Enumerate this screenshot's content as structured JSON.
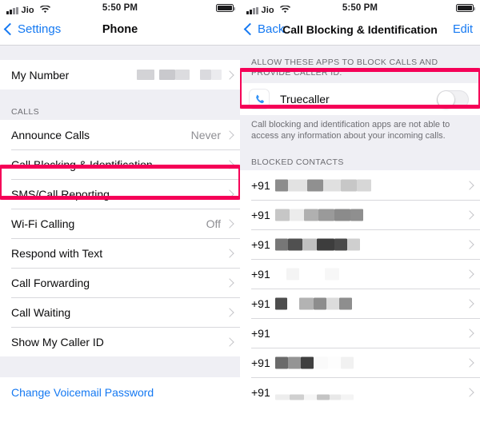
{
  "status_bar": {
    "carrier": "Jio",
    "time": "5:50 PM",
    "signal_icon": "cellular-bars-icon",
    "wifi_icon": "wifi-icon",
    "battery_icon": "battery-full-icon"
  },
  "left_panel": {
    "nav": {
      "back_label": "Settings",
      "title": "Phone",
      "back_icon": "chevron-left-icon"
    },
    "sections": [
      {
        "header": "",
        "rows": [
          {
            "label": "My Number",
            "value": "",
            "redacted": true,
            "accessory": "chevron-right-icon"
          }
        ]
      },
      {
        "header": "CALLS",
        "rows": [
          {
            "label": "Announce Calls",
            "value": "Never",
            "accessory": "chevron-right-icon"
          },
          {
            "label": "Call Blocking & Identification",
            "value": "",
            "accessory": "chevron-right-icon",
            "highlighted": true
          },
          {
            "label": "SMS/Call Reporting",
            "value": "",
            "accessory": "chevron-right-icon"
          },
          {
            "label": "Wi-Fi Calling",
            "value": "Off",
            "accessory": "chevron-right-icon"
          },
          {
            "label": "Respond with Text",
            "value": "",
            "accessory": "chevron-right-icon"
          },
          {
            "label": "Call Forwarding",
            "value": "",
            "accessory": "chevron-right-icon"
          },
          {
            "label": "Call Waiting",
            "value": "",
            "accessory": "chevron-right-icon"
          },
          {
            "label": "Show My Caller ID",
            "value": "",
            "accessory": "chevron-right-icon"
          }
        ]
      }
    ],
    "voicemail_link": "Change Voicemail Password"
  },
  "right_panel": {
    "nav": {
      "back_label": "Back",
      "title": "Call Blocking & Identification",
      "edit_label": "Edit",
      "back_icon": "chevron-left-icon"
    },
    "apps_section": {
      "header": "ALLOW THESE APPS TO BLOCK CALLS AND PROVIDE CALLER ID:",
      "apps": [
        {
          "name": "Truecaller",
          "icon": "phone-handset-icon",
          "toggle_state": "off",
          "highlighted": true
        }
      ],
      "footer": "Call blocking and identification apps are not able to access any information about your incoming calls."
    },
    "blocked_section": {
      "header": "BLOCKED CONTACTS",
      "country_code": "+91",
      "rows": [
        {
          "prefix": "+91",
          "number": "",
          "redacted": true,
          "accessory": "chevron-right-icon"
        },
        {
          "prefix": "+91",
          "number": "",
          "redacted": true,
          "accessory": "chevron-right-icon"
        },
        {
          "prefix": "+91",
          "number": "",
          "redacted": true,
          "accessory": "chevron-right-icon"
        },
        {
          "prefix": "+91",
          "number": "",
          "redacted": true,
          "accessory": "chevron-right-icon"
        },
        {
          "prefix": "+91",
          "number": "",
          "redacted": true,
          "accessory": "chevron-right-icon"
        },
        {
          "prefix": "+91",
          "number": "",
          "redacted": true,
          "accessory": "chevron-right-icon"
        },
        {
          "prefix": "+91",
          "number": "",
          "redacted": true,
          "accessory": "chevron-right-icon"
        },
        {
          "prefix": "+91",
          "number": "",
          "redacted": true,
          "accessory": "chevron-right-icon"
        }
      ]
    }
  },
  "colors": {
    "highlight": "#f50057",
    "link": "#1579f2",
    "app_icon_blue": "#2f90f5",
    "group_background": "#efeff4",
    "separator": "#d8d8dc",
    "secondary_text": "#8e8e93"
  }
}
